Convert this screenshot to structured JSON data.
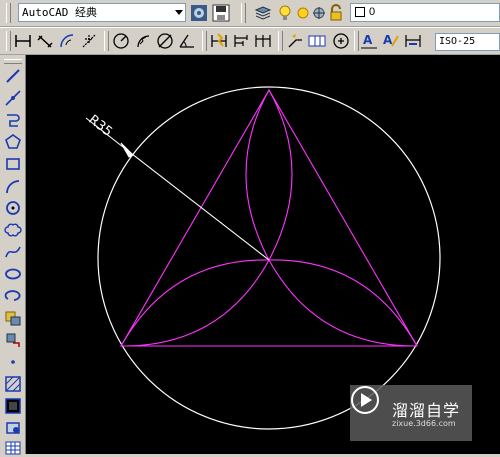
{
  "toolbar_top": {
    "workspace_value": "AutoCAD 经典",
    "layer_value": "0",
    "icons": [
      "workspace-settings-icon",
      "save-workspace-icon",
      "layer-manager-icon",
      "light-bulb-icon",
      "sun-icon",
      "freeze-icon",
      "lock-icon",
      "color-swatch-icon"
    ]
  },
  "toolbar_dim": {
    "dimstyle_value": "ISO-25",
    "icons": [
      "linear-dim-icon",
      "aligned-dim-icon",
      "arc-length-dim-icon",
      "ordinate-dim-icon",
      "radius-dim-icon",
      "jogged-dim-icon",
      "diameter-dim-icon",
      "angular-dim-icon",
      "quick-dim-icon",
      "baseline-dim-icon",
      "continue-dim-icon",
      "quick-leader-icon",
      "tolerance-icon",
      "center-mark-icon",
      "dim-edit-icon",
      "dim-text-edit-icon",
      "dim-update-icon"
    ]
  },
  "draw_toolbar": {
    "tools": [
      "line-icon",
      "construction-line-icon",
      "polyline-icon",
      "polygon-icon",
      "rectangle-icon",
      "arc-icon",
      "circle-icon",
      "revision-cloud-icon",
      "spline-icon",
      "ellipse-icon",
      "ellipse-arc-icon",
      "insert-block-icon",
      "make-block-icon",
      "point-icon",
      "hatch-icon",
      "gradient-icon",
      "region-icon",
      "table-icon"
    ]
  },
  "drawing": {
    "dimension_text": "R35",
    "circle_color": "#ffffff",
    "geometry_color": "#ff33ff",
    "dimension_color": "#ffffff"
  },
  "watermark": {
    "title": "溜溜自学",
    "url": "zixue.3d66.com"
  }
}
